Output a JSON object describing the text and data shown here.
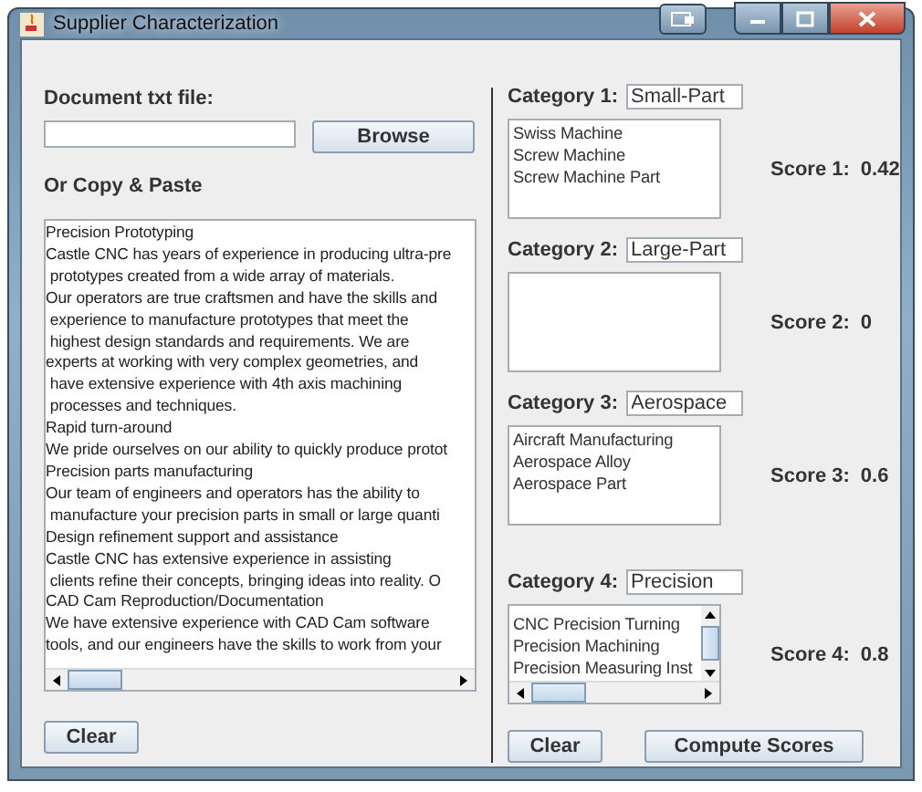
{
  "window": {
    "title": "Supplier Characterization"
  },
  "document": {
    "label": "Document txt file:",
    "browse_button": "Browse",
    "paste_label": "Or Copy & Paste",
    "text_lines": [
      "Precision Prototyping",
      "Castle CNC has years of experience in producing ultra-pre",
      " prototypes created from a wide array of materials.",
      "Our operators are true craftsmen and have the skills and",
      " experience to manufacture prototypes that meet the",
      " highest design standards and requirements. We are",
      "experts at working with very complex geometries, and",
      " have extensive experience with 4th axis machining",
      " processes and techniques.",
      "Rapid turn-around",
      "We pride ourselves on our ability to quickly produce protot",
      "Precision parts manufacturing",
      "Our team of engineers and operators has the ability to",
      " manufacture your precision parts in small or large quanti",
      "Design refinement support and assistance",
      "Castle CNC has extensive experience in assisting",
      " clients refine their concepts, bringing ideas into reality. O",
      "CAD Cam Reproduction/Documentation",
      "We have extensive experience with CAD Cam software",
      "tools, and our engineers have the skills to work from your"
    ],
    "clear_button": "Clear"
  },
  "categories": [
    {
      "label": "Category 1:",
      "value": "Small-Part",
      "items": [
        "Swiss Machine",
        "Screw Machine",
        "Screw Machine Part"
      ],
      "score_label": "Score 1:",
      "score": "0.42",
      "scrollable": false
    },
    {
      "label": "Category 2:",
      "value": "Large-Part",
      "score_label": "Score 2:",
      "score": "0",
      "scrollable": false
    },
    {
      "label": "Category 3:",
      "value": "Aerospace",
      "items": [
        "Aircraft Manufacturing",
        "Aerospace Alloy",
        "Aerospace Part"
      ],
      "score_label": "Score 3:",
      "score": "0.6",
      "scrollable": false
    },
    {
      "label": "Category 4:",
      "value": "Precision",
      "items": [
        "CNC Precision Turning",
        "Precision Machining",
        "Precision Measuring Inst"
      ],
      "score_label": "Score 4:",
      "score": "0.8",
      "scrollable": true
    }
  ],
  "buttons": {
    "clear": "Clear",
    "compute": "Compute Scores"
  }
}
